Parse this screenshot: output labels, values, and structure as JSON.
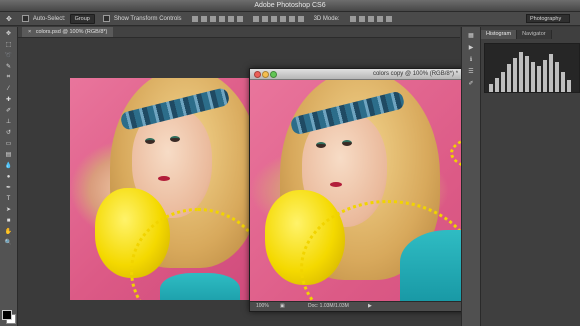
{
  "app": {
    "title": "Adobe Photoshop CS6"
  },
  "options_bar": {
    "auto_select_label": "Auto-Select:",
    "auto_select_value": "Group",
    "show_transform_label": "Show Transform Controls",
    "mode_3d_label": "3D Mode:",
    "workspace": "Photography"
  },
  "document_tab": {
    "label": "colors.psd @ 100% (RGB/8*)"
  },
  "window2": {
    "title": "colors copy @ 100% (RGB/8*) *",
    "zoom": "100%",
    "doc_size": "Doc: 1.03M/1.03M"
  },
  "panels": {
    "tabs": [
      "Histogram",
      "Navigator"
    ]
  },
  "colors": {
    "foreground": "#000000",
    "background": "#ffffff"
  },
  "tool_icons": [
    "move-tool-icon",
    "marquee-tool-icon",
    "lasso-tool-icon",
    "quick-select-tool-icon",
    "crop-tool-icon",
    "eyedropper-tool-icon",
    "healing-brush-tool-icon",
    "brush-tool-icon",
    "clone-stamp-tool-icon",
    "history-brush-tool-icon",
    "eraser-tool-icon",
    "gradient-tool-icon",
    "blur-tool-icon",
    "dodge-tool-icon",
    "pen-tool-icon",
    "type-tool-icon",
    "path-select-tool-icon",
    "shape-tool-icon",
    "hand-tool-icon",
    "zoom-tool-icon"
  ]
}
